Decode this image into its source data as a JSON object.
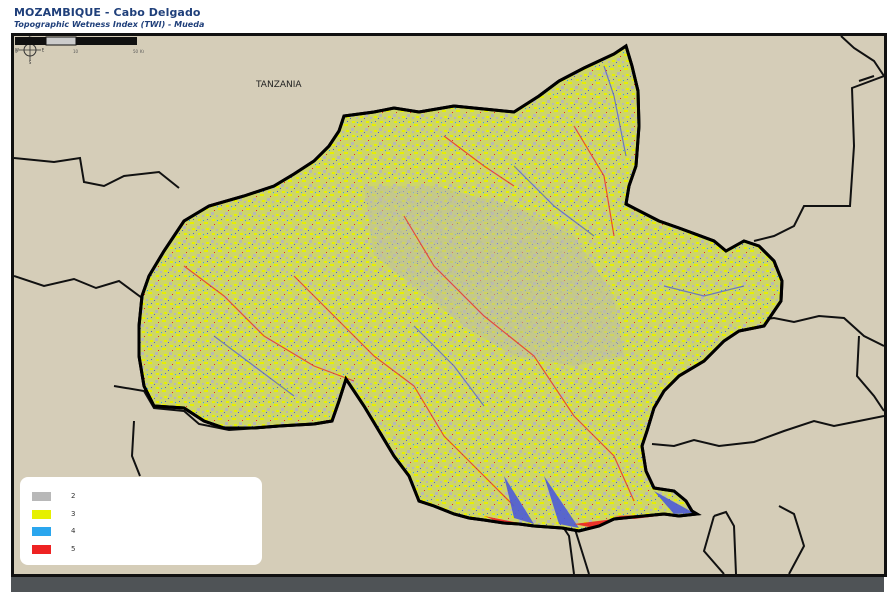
{
  "header": {
    "title": "MOZAMBIQUE - Cabo Delgado",
    "subtitle": "Topographic Wetness Index (TWI) - Mueda"
  },
  "map": {
    "label_neighbor": "TANZANIA",
    "north_arrow": {
      "n": "N",
      "s": "S",
      "e": "E",
      "w": "W"
    },
    "scale_bar": {
      "ticks": [
        "0",
        "10",
        "50"
      ],
      "unit": "Km"
    },
    "colors": {
      "background": "#d5cdb8",
      "district_base": "#c9d36a",
      "class_2": "#b8b8b8",
      "class_3": "#e6f000",
      "class_4": "#2aa6ee",
      "class_5": "#ee2222",
      "boundary": "#111111",
      "blue_streams": "#4d5bd8"
    }
  },
  "legend": {
    "items": [
      {
        "label": "2",
        "color": "#b8b8b8"
      },
      {
        "label": "3",
        "color": "#e6f000"
      },
      {
        "label": "4",
        "color": "#2aa6ee"
      },
      {
        "label": "5",
        "color": "#ee2222"
      }
    ]
  }
}
